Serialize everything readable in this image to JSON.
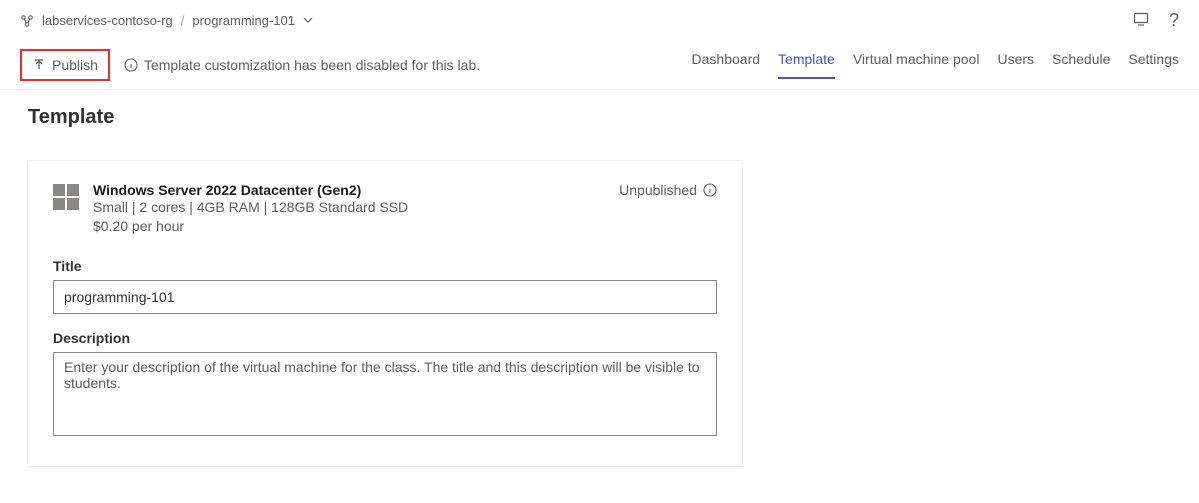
{
  "breadcrumb": {
    "root": "labservices-contoso-rg",
    "sep": "/",
    "current": "programming-101"
  },
  "toolbar": {
    "publish_label": "Publish",
    "info_msg": "Template customization has been disabled for this lab."
  },
  "tabs": {
    "dashboard": "Dashboard",
    "template": "Template",
    "vmpool": "Virtual machine pool",
    "users": "Users",
    "schedule": "Schedule",
    "settings": "Settings"
  },
  "page": {
    "title": "Template",
    "vm": {
      "name": "Windows Server 2022 Datacenter (Gen2)",
      "spec": "Small | 2 cores | 4GB RAM | 128GB Standard SSD",
      "price": "$0.20 per hour",
      "status": "Unpublished"
    },
    "form": {
      "title_label": "Title",
      "title_value": "programming-101",
      "desc_label": "Description",
      "desc_placeholder": "Enter your description of the virtual machine for the class. The title and this description will be visible to students."
    }
  }
}
